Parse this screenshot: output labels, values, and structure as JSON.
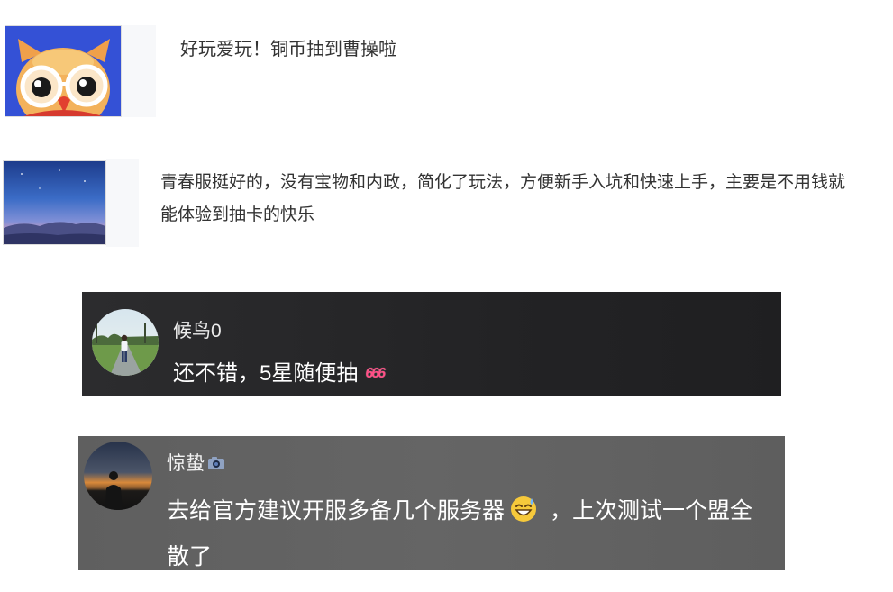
{
  "comments": [
    {
      "avatar_icon": "owl-avatar",
      "text": "好玩爱玩！铜币抽到曹操啦"
    },
    {
      "avatar_icon": "night-sky-avatar",
      "lines": [
        "青春服挺好的，没有宝物和内政，简化了玩法，方便新手入坑和快速上手，主要是不用钱就",
        "能体验到抽卡的快乐"
      ]
    },
    {
      "avatar_icon": "person-on-road-avatar",
      "username": "候鸟0",
      "text": "还不错，5星随便抽",
      "sticker": "666",
      "sticker_color": "#ff4f86",
      "card_color": "#252527"
    },
    {
      "avatar_icon": "sunset-silhouette-avatar",
      "username": "惊蛰",
      "badge_icon": "camera-icon",
      "line1_before": "去给官方建议开服多备几个服务器",
      "emoji": "grinning-sweat-emoji",
      "line1_after": "，上次测试一个盟全",
      "line2": "散了",
      "card_color": "#626262"
    }
  ]
}
